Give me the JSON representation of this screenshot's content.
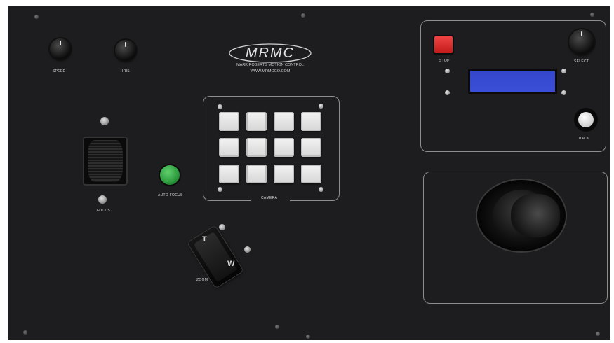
{
  "logo": {
    "text": "MRMC",
    "company": "MARK ROBERTS MOTION CONTROL",
    "url": "WWW.MRMOCO.COM"
  },
  "labels": {
    "speed": "SPEED",
    "iris": "IRIS",
    "focus": "FOCUS",
    "auto_focus": "AUTO FOCUS",
    "camera": "CAMERA",
    "zoom": "ZOOM",
    "stop": "STOP",
    "select": "SELECT",
    "back": "BACK"
  },
  "zoom_rocker": {
    "tele": "T",
    "wide": "W"
  },
  "colors": {
    "panel": "#1d1d1f",
    "stop_button": "#e02a2a",
    "auto_focus_button": "#2e9a3e",
    "lcd": "#3b4fd6"
  }
}
